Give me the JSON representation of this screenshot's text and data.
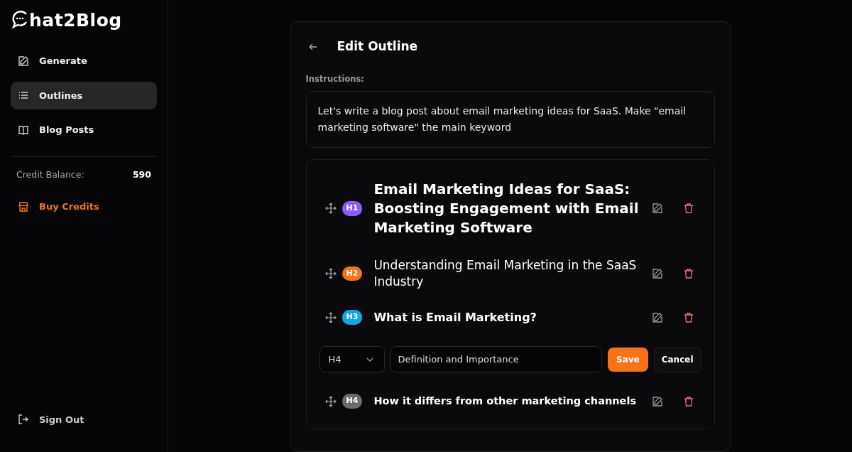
{
  "sidebar": {
    "logo": "hat2Blog",
    "nav": [
      {
        "label": "Generate",
        "kind": "edit",
        "selected": false
      },
      {
        "label": "Outlines",
        "kind": "list",
        "selected": true
      },
      {
        "label": "Blog Posts",
        "kind": "book",
        "selected": false
      }
    ],
    "credit_label": "Credit Balance:",
    "credit_value": "590",
    "buy_credits": "Buy Credits",
    "sign_out": "Sign Out"
  },
  "page": {
    "title": "Edit Outline",
    "instructions_label": "Instructions:",
    "instructions": "Let's write a blog post about email marketing ideas for SaaS. Make \"email marketing software\" the main keyword"
  },
  "outline": [
    {
      "kind": "heading",
      "level": "H1",
      "color": "#8b5cf6",
      "title": "Email Marketing Ideas for SaaS: Boosting Engagement with Email Marketing Software"
    },
    {
      "kind": "heading",
      "level": "H2",
      "color": "#f97316",
      "title": "Understanding Email Marketing in the SaaS Industry"
    },
    {
      "kind": "heading",
      "level": "H3",
      "color": "#0ea5e9",
      "title": "What is Email Marketing?"
    },
    {
      "kind": "editor",
      "level": "H4",
      "value": "Definition and Importance",
      "save": "Save",
      "cancel": "Cancel"
    },
    {
      "kind": "heading",
      "level": "H4",
      "color": "#6b6b6b",
      "title": "How it differs from other marketing channels"
    }
  ]
}
